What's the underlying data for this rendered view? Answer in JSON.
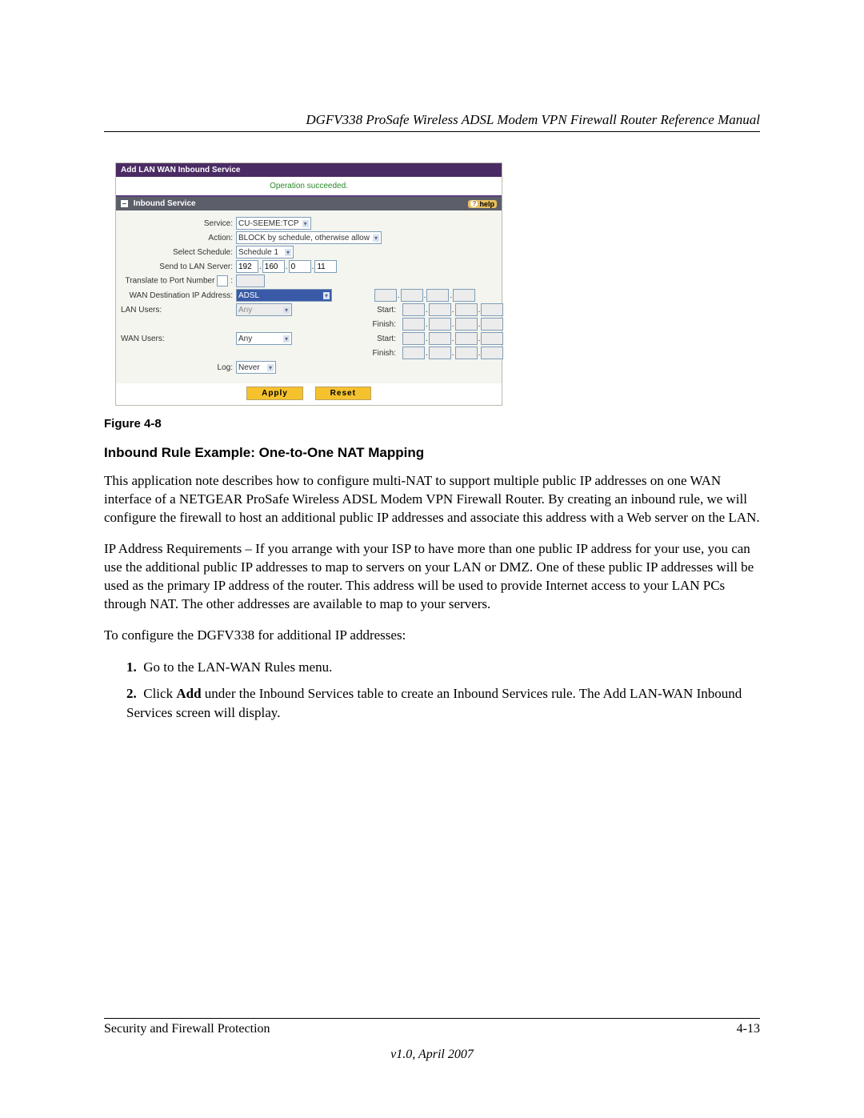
{
  "doc": {
    "header": "DGFV338 ProSafe Wireless ADSL Modem VPN Firewall Router Reference Manual",
    "figure_caption": "Figure 4-8",
    "section_title": "Inbound Rule Example: One-to-One NAT Mapping",
    "p1": "This application note describes how to configure multi-NAT to support multiple public IP addresses on one WAN interface of a NETGEAR ProSafe Wireless ADSL Modem VPN Firewall Router.  By creating an inbound rule, we will configure the firewall to host an additional public IP addresses and associate this address with a Web server on the LAN.",
    "p2": "IP Address Requirements – If you arrange with your ISP to have more than one public IP address for your use, you can use the additional public IP addresses to map to servers on your LAN or DMZ. One of these public IP addresses will be used as the primary IP address of the router. This address will be used to provide Internet access to your LAN PCs through NAT. The other addresses are available to map to your servers.",
    "p3": "To configure the DGFV338 for additional IP addresses:",
    "steps": [
      {
        "n": "1.",
        "t_pre": "Go to the LAN-WAN Rules menu."
      },
      {
        "n": "2.",
        "t_pre": "Click ",
        "bold": "Add",
        "t_post": " under the Inbound Services table to create an Inbound Services rule. The Add LAN-WAN Inbound Services screen will display."
      }
    ],
    "footer_left": "Security and Firewall Protection",
    "footer_right": "4-13",
    "footer_version": "v1.0, April 2007"
  },
  "ui": {
    "title": "Add LAN WAN Inbound Service",
    "success": "Operation succeeded.",
    "section_label": "Inbound Service",
    "help": "help",
    "labels": {
      "service": "Service:",
      "action": "Action:",
      "schedule": "Select Schedule:",
      "lan_server": "Send to LAN Server:",
      "translate": "Translate to Port Number",
      "wan_dest": "WAN Destination IP Address:",
      "lan_users": "LAN Users:",
      "wan_users": "WAN Users:",
      "log": "Log:",
      "start": "Start:",
      "finish": "Finish:"
    },
    "values": {
      "service": "CU-SEEME:TCP",
      "action": "BLOCK by schedule, otherwise allow",
      "schedule": "Schedule 1",
      "lan_server_ip": [
        "192",
        "160",
        "0",
        "11"
      ],
      "translate_enabled": false,
      "translate_port": "",
      "wan_dest": "ADSL",
      "lan_users": "Any",
      "wan_users": "Any",
      "log": "Never",
      "lan_start": [
        "",
        "",
        "",
        ""
      ],
      "lan_finish": [
        "",
        "",
        "",
        ""
      ],
      "wan_start": [
        "",
        "",
        "",
        ""
      ],
      "wan_finish": [
        "",
        "",
        "",
        ""
      ]
    },
    "buttons": {
      "apply": "Apply",
      "reset": "Reset"
    }
  }
}
